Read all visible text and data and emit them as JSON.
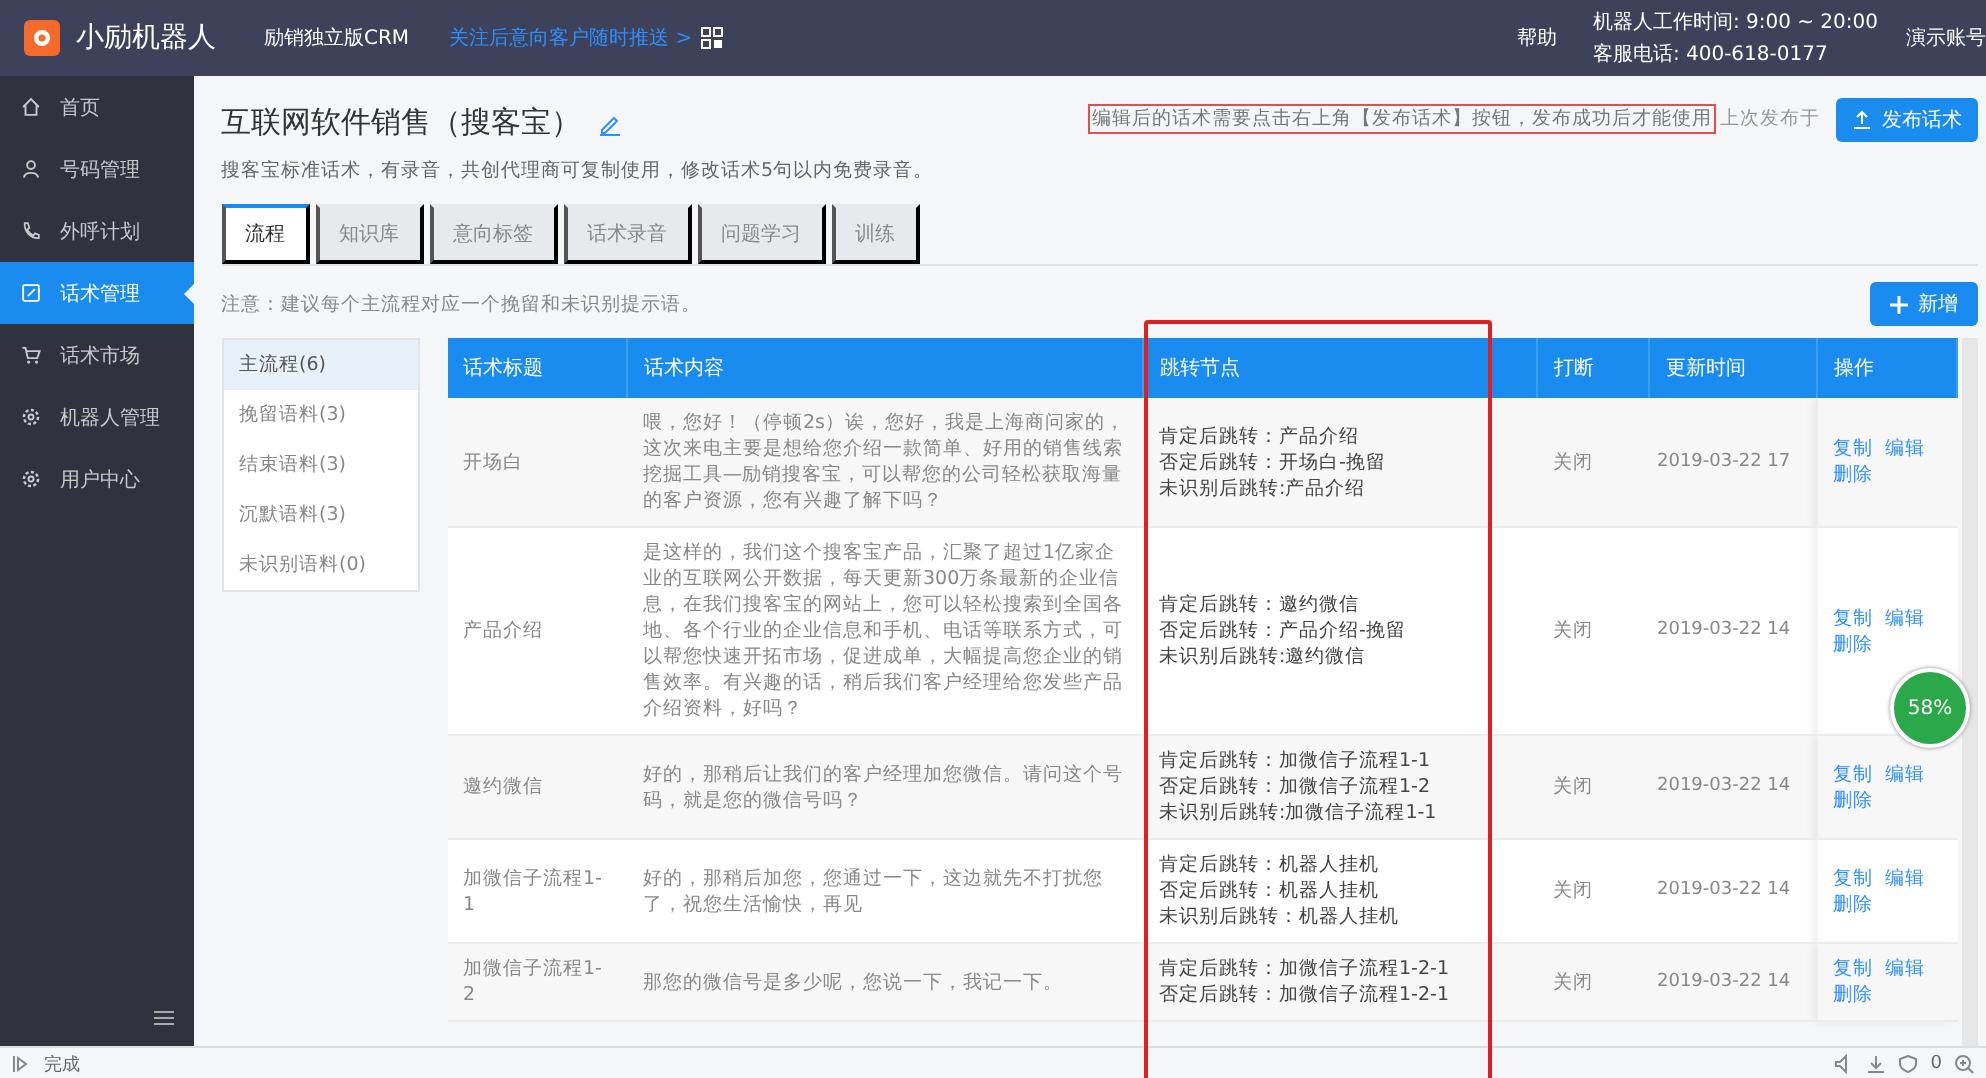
{
  "header": {
    "brand": "小励机器人",
    "product": "励销独立版CRM",
    "promo_link": "关注后意向客户随时推送 >",
    "help": "帮助",
    "work_hours": "机器人工作时间: 9:00 ~ 20:00",
    "service_phone": "客服电话: 400-618-0177",
    "account": "演示账号"
  },
  "sidebar": {
    "items": [
      {
        "label": "首页",
        "selected": false
      },
      {
        "label": "号码管理",
        "selected": false
      },
      {
        "label": "外呼计划",
        "selected": false
      },
      {
        "label": "话术管理",
        "selected": true
      },
      {
        "label": "话术市场",
        "selected": false
      },
      {
        "label": "机器人管理",
        "selected": false
      },
      {
        "label": "用户中心",
        "selected": false
      }
    ]
  },
  "page": {
    "title": "互联网软件销售（搜客宝）",
    "description": "搜客宝标准话术，有录音，共创代理商可复制使用，修改话术5句以内免费录音。",
    "publish_hint": "编辑后的话术需要点击右上角【发布话术】按钮，发布成功后才能使用",
    "last_published": "上次发布于",
    "publish_button": "发布话术"
  },
  "tabs": [
    {
      "label": "流程",
      "selected": true
    },
    {
      "label": "知识库",
      "selected": false
    },
    {
      "label": "意向标签",
      "selected": false
    },
    {
      "label": "话术录音",
      "selected": false
    },
    {
      "label": "问题学习",
      "selected": false
    },
    {
      "label": "训练",
      "selected": false
    }
  ],
  "note": "注意：建议每个主流程对应一个挽留和未识别提示语。",
  "add_button": "新增",
  "categories": [
    {
      "label": "主流程(6)",
      "selected": true
    },
    {
      "label": "挽留语料(3)",
      "selected": false
    },
    {
      "label": "结束语料(3)",
      "selected": false
    },
    {
      "label": "沉默语料(3)",
      "selected": false
    },
    {
      "label": "未识别语料(0)",
      "selected": false
    }
  ],
  "table": {
    "columns": [
      "话术标题",
      "话术内容",
      "跳转节点",
      "打断",
      "更新时间",
      "操作"
    ],
    "rows": [
      {
        "title": "开场白",
        "content": "喂，您好！（停顿2s）诶，您好，我是上海商问家的，这次来电主要是想给您介绍一款简单、好用的销售线索挖掘工具—励销搜客宝，可以帮您的公司轻松获取海量的客户资源，您有兴趣了解下吗？",
        "jumps": [
          "肯定后跳转：产品介绍",
          "否定后跳转：开场白-挽留",
          "未识别后跳转:产品介绍"
        ],
        "interrupt": "关闭",
        "updated": "2019-03-22 17",
        "actions": [
          "复制",
          "编辑",
          "删除"
        ]
      },
      {
        "title": "产品介绍",
        "content": "是这样的，我们这个搜客宝产品，汇聚了超过1亿家企业的互联网公开数据，每天更新300万条最新的企业信息，在我们搜客宝的网站上，您可以轻松搜索到全国各地、各个行业的企业信息和手机、电话等联系方式，可以帮您快速开拓市场，促进成单，大幅提高您企业的销售效率。有兴趣的话，稍后我们客户经理给您发些产品介绍资料，好吗？",
        "jumps": [
          "肯定后跳转：邀约微信",
          "否定后跳转：产品介绍-挽留",
          "未识别后跳转:邀约微信"
        ],
        "interrupt": "关闭",
        "updated": "2019-03-22 14",
        "actions": [
          "复制",
          "编辑",
          "删除"
        ]
      },
      {
        "title": "邀约微信",
        "content": "好的，那稍后让我们的客户经理加您微信。请问这个号码，就是您的微信号吗？",
        "jumps": [
          "肯定后跳转：加微信子流程1-1",
          "否定后跳转：加微信子流程1-2",
          "未识别后跳转:加微信子流程1-1"
        ],
        "interrupt": "关闭",
        "updated": "2019-03-22 14",
        "actions": [
          "复制",
          "编辑",
          "删除"
        ]
      },
      {
        "title": "加微信子流程1-1",
        "content": "好的，那稍后加您，您通过一下，这边就先不打扰您了，祝您生活愉快，再见",
        "jumps": [
          "肯定后跳转：机器人挂机",
          "否定后跳转：机器人挂机",
          "未识别后跳转：机器人挂机"
        ],
        "interrupt": "关闭",
        "updated": "2019-03-22 14",
        "actions": [
          "复制",
          "编辑",
          "删除"
        ]
      },
      {
        "title": "加微信子流程1-2",
        "content": "那您的微信号是多少呢，您说一下，我记一下。",
        "jumps": [
          "肯定后跳转：加微信子流程1-2-1",
          "否定后跳转：加微信子流程1-2-1"
        ],
        "interrupt": "关闭",
        "updated": "2019-03-22 14",
        "actions": [
          "复制",
          "编辑",
          "删除"
        ]
      }
    ]
  },
  "speed_widget": {
    "reading": "58%"
  },
  "status_bar": {
    "text": "完成",
    "counter": "0"
  }
}
